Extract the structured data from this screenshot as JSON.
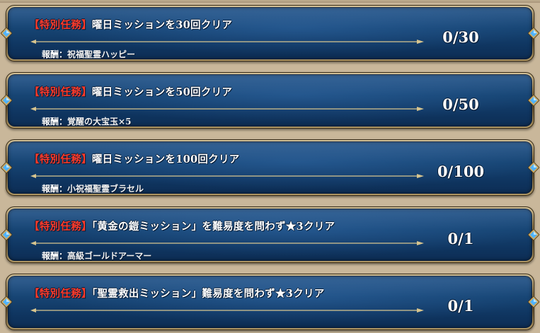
{
  "missions": [
    {
      "tag": "【特別任務】",
      "title": "曜日ミッションを30回クリア",
      "reward_label": "報酬：",
      "reward": "祝福聖霊ハッピー",
      "progress": "0/30"
    },
    {
      "tag": "【特別任務】",
      "title": "曜日ミッションを50回クリア",
      "reward_label": "報酬：",
      "reward": "覚醒の大宝玉×5",
      "progress": "0/50"
    },
    {
      "tag": "【特別任務】",
      "title": "曜日ミッションを100回クリア",
      "reward_label": "報酬：",
      "reward": "小祝福聖霊ブラセル",
      "progress": "0/100"
    },
    {
      "tag": "【特別任務】",
      "title": "「黄金の鎧ミッション」を難易度を問わず★3クリア",
      "reward_label": "報酬：",
      "reward": "高級ゴールドアーマー",
      "progress": "0/1"
    },
    {
      "tag": "【特別任務】",
      "title": "「聖霊救出ミッション」難易度を問わず★3クリア",
      "reward_label": "",
      "reward": "",
      "progress": "0/1"
    }
  ],
  "colors": {
    "tag": "#ff3b2b",
    "panel": "#174574",
    "frame_gold": "#b29a66",
    "gem_blue": "#4fb4ff"
  },
  "icons": {
    "gem": "blue-diamond-gem-icon"
  }
}
